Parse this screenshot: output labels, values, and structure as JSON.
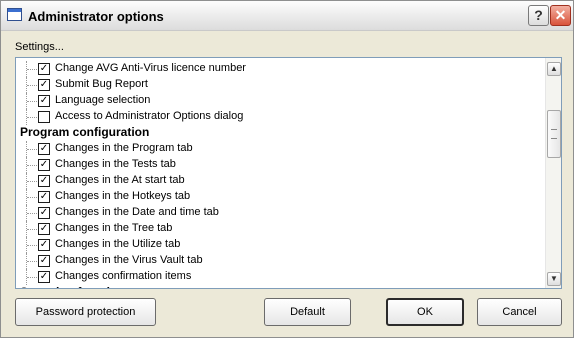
{
  "window": {
    "title": "Administrator options",
    "help_glyph": "?",
    "close_glyph": "✕",
    "icons": [
      "app-window-icon",
      "help-icon",
      "close-icon"
    ]
  },
  "settings_label": "Settings...",
  "tree": {
    "rows": [
      {
        "kind": "item",
        "label": "Change AVG Anti-Virus licence number",
        "checked": true
      },
      {
        "kind": "item",
        "label": "Submit Bug Report",
        "checked": true
      },
      {
        "kind": "item",
        "label": "Language selection",
        "checked": true
      },
      {
        "kind": "item",
        "label": "Access to Administrator Options dialog",
        "checked": false
      },
      {
        "kind": "header",
        "label": "Program configuration"
      },
      {
        "kind": "item",
        "label": "Changes in the Program tab",
        "checked": true
      },
      {
        "kind": "item",
        "label": "Changes in the Tests tab",
        "checked": true
      },
      {
        "kind": "item",
        "label": "Changes in the At start tab",
        "checked": true
      },
      {
        "kind": "item",
        "label": "Changes in the Hotkeys tab",
        "checked": true
      },
      {
        "kind": "item",
        "label": "Changes in the Date and time tab",
        "checked": true
      },
      {
        "kind": "item",
        "label": "Changes in the Tree tab",
        "checked": true
      },
      {
        "kind": "item",
        "label": "Changes in the Utilize tab",
        "checked": true
      },
      {
        "kind": "item",
        "label": "Changes in the Virus Vault tab",
        "checked": true
      },
      {
        "kind": "item",
        "label": "Changes confirmation items",
        "checked": true
      },
      {
        "kind": "header",
        "label": "Scanning functions"
      }
    ],
    "check_glyph": "✓"
  },
  "scrollbar": {
    "up_glyph": "▲",
    "down_glyph": "▼"
  },
  "buttons": {
    "password_protection": "Password protection",
    "default": "Default",
    "ok": "OK",
    "cancel": "Cancel"
  }
}
